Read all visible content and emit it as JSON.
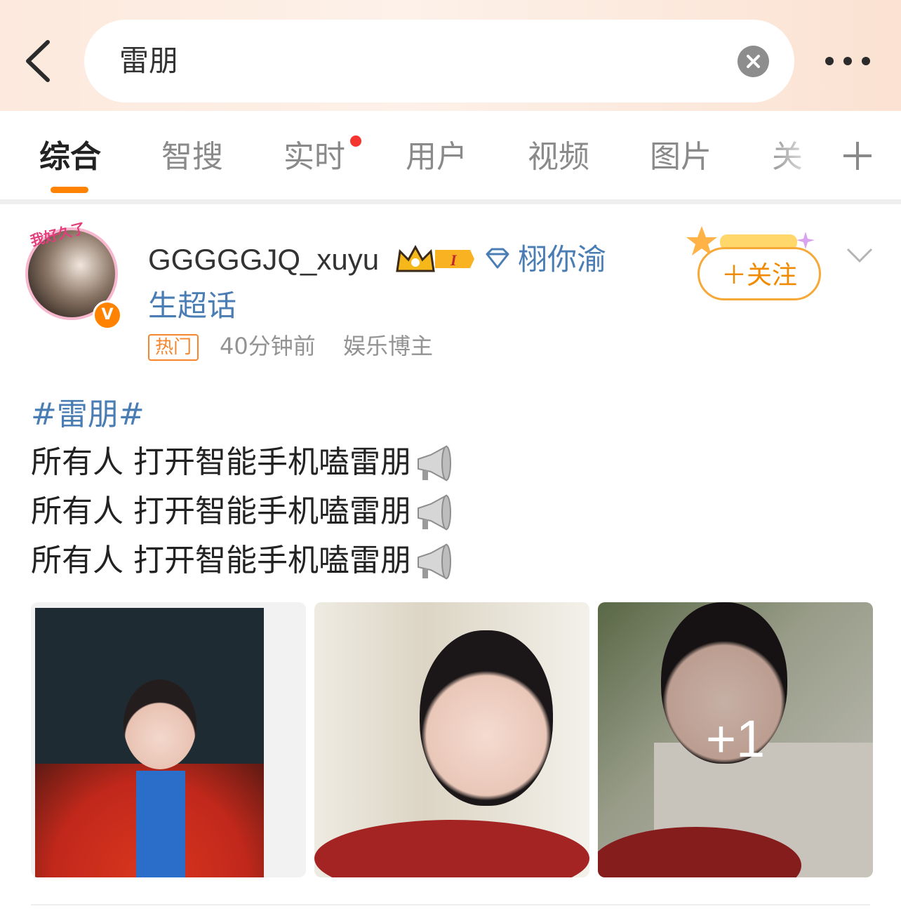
{
  "search": {
    "query": "雷朋"
  },
  "tabs": [
    {
      "label": "综合",
      "active": true
    },
    {
      "label": "智搜"
    },
    {
      "label": "实时",
      "has_red_dot": true
    },
    {
      "label": "用户"
    },
    {
      "label": "视频"
    },
    {
      "label": "图片"
    },
    {
      "label": "关"
    }
  ],
  "post": {
    "username": "GGGGGJQ_xuyu",
    "avatar_frame_text": "我好久了",
    "supertopic_line1": "栩你渝",
    "supertopic_line2": "生超话",
    "hot_tag": "热门",
    "time": "40分钟前",
    "role": "娱乐博主",
    "follow_label": "＋关注",
    "hashtag": "#雷朋#",
    "lines": [
      "所有人 打开智能手机嗑雷朋",
      "所有人 打开智能手机嗑雷朋",
      "所有人 打开智能手机嗑雷朋"
    ],
    "more_images": "+1",
    "icons": {
      "back": "back-arrow-icon",
      "clear": "clear-icon",
      "more": "more-dots-icon",
      "crown": "crown-badge-icon",
      "diamond": "diamond-icon",
      "megaphone": "megaphone-icon",
      "collapse": "chevron-down-icon"
    }
  },
  "colors": {
    "accent": "#ff8200",
    "link": "#4a7db3",
    "follow": "#f08a00"
  }
}
